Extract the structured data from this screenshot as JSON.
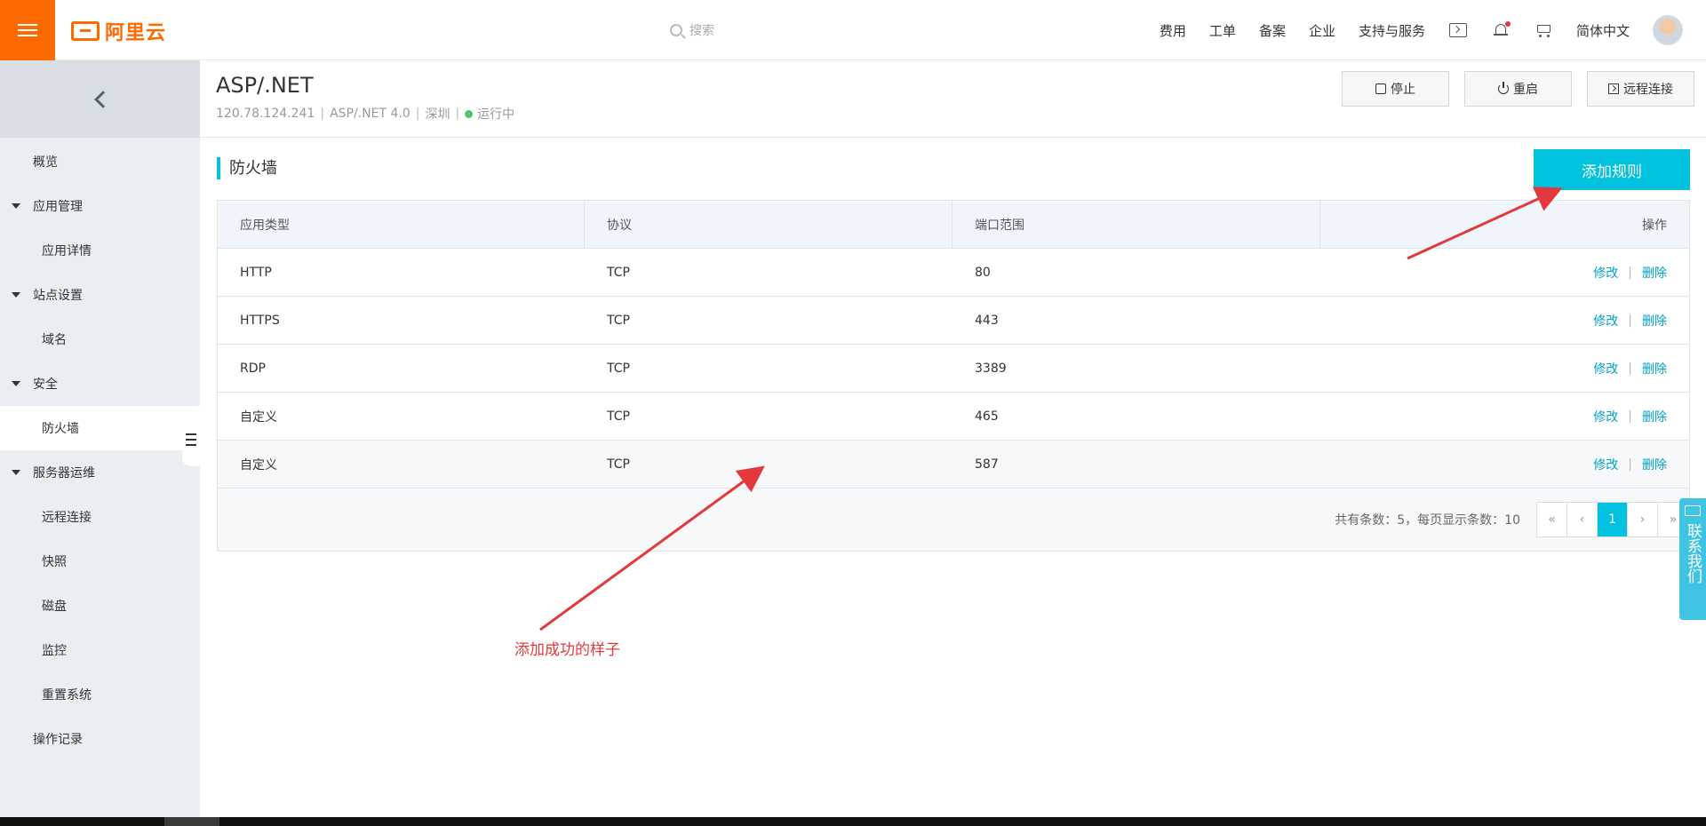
{
  "topbar": {
    "brand": "阿里云",
    "search_placeholder": "搜索",
    "nav": [
      "费用",
      "工单",
      "备案",
      "企业",
      "支持与服务"
    ],
    "language": "简体中文",
    "icons": [
      "terminal-icon",
      "bell-icon",
      "cart-icon"
    ],
    "brand_color": "#ff6a00"
  },
  "sidebar": {
    "items": [
      {
        "label": "概览",
        "level": 0
      },
      {
        "label": "应用管理",
        "level": "group"
      },
      {
        "label": "应用详情",
        "level": 1
      },
      {
        "label": "站点设置",
        "level": "group"
      },
      {
        "label": "域名",
        "level": 1
      },
      {
        "label": "安全",
        "level": "group"
      },
      {
        "label": "防火墙",
        "level": 1,
        "active": true
      },
      {
        "label": "服务器运维",
        "level": "group"
      },
      {
        "label": "远程连接",
        "level": 1
      },
      {
        "label": "快照",
        "level": 1
      },
      {
        "label": "磁盘",
        "level": 1
      },
      {
        "label": "监控",
        "level": 1
      },
      {
        "label": "重置系统",
        "level": 1
      },
      {
        "label": "操作记录",
        "level": 0
      }
    ]
  },
  "header": {
    "title": "ASP/.NET",
    "ip": "120.78.124.241",
    "stack": "ASP/.NET 4.0",
    "region": "深圳",
    "status": "运行中",
    "status_color": "#4dc86f",
    "stop_label": "停止",
    "restart_label": "重启",
    "remote_label": "远程连接"
  },
  "firewall": {
    "section_title": "防火墙",
    "add_label": "添加规则",
    "accent": "#00c1de",
    "columns": [
      "应用类型",
      "协议",
      "端口范围",
      "操作"
    ],
    "rows": [
      {
        "type": "HTTP",
        "protocol": "TCP",
        "port": "80"
      },
      {
        "type": "HTTPS",
        "protocol": "TCP",
        "port": "443"
      },
      {
        "type": "RDP",
        "protocol": "TCP",
        "port": "3389"
      },
      {
        "type": "自定义",
        "protocol": "TCP",
        "port": "465"
      },
      {
        "type": "自定义",
        "protocol": "TCP",
        "port": "587"
      }
    ],
    "edit_label": "修改",
    "delete_label": "删除",
    "pager_info": "共有条数：5，每页显示条数：10",
    "pager": [
      "«",
      "‹",
      "1",
      "›",
      "»"
    ],
    "current_page": "1"
  },
  "annotation": {
    "note": "添加成功的样子",
    "color": "#e4393c"
  },
  "contact": {
    "label": "联系我们"
  }
}
